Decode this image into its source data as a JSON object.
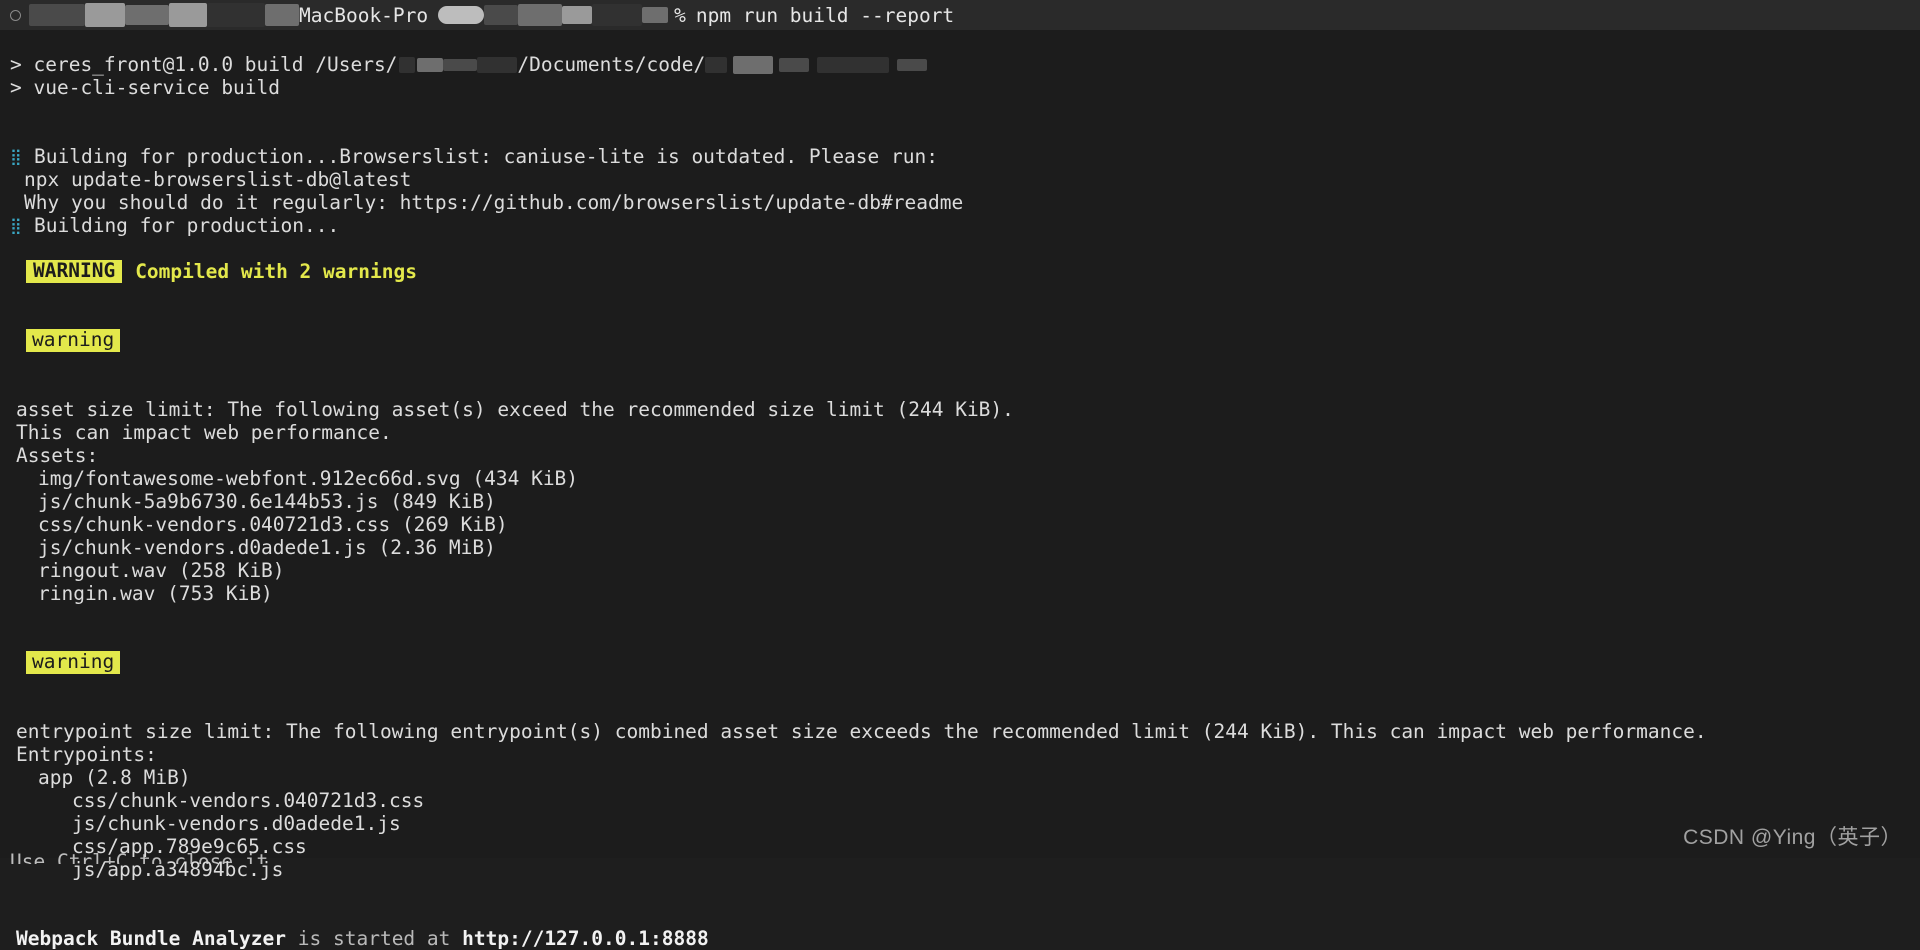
{
  "terminal": {
    "theme": {
      "background": "#1c1c1c",
      "prompt_bar_background": "#2a2a2a",
      "foreground": "#d8d8d8",
      "warning_badge_background": "#e3e84b",
      "warning_badge_foreground": "#1c1c1c",
      "warning_text": "#e3e84b",
      "spinner_color": "#3aa7c4"
    },
    "prompt": {
      "host_suffix": "MacBook-Pro",
      "prompt_symbol": "%",
      "command": "npm run build --report",
      "redacted_user": "",
      "redacted_path": ""
    },
    "npm_header": {
      "line1_prefix": "> ceres_front@1.0.0 build /Users/",
      "line1_middle": "/Documents/code/",
      "line2": "> vue-cli-service build"
    },
    "build_lines": {
      "spinner_glyph": "⣿",
      "building_browserslist": "Building for production...Browserslist: caniuse-lite is outdated. Please run:",
      "npx_update": "npx update-browserslist-db@latest",
      "why_regularly": "Why you should do it regularly: https://github.com/browserslist/update-db#readme",
      "building_again": "Building for production..."
    },
    "compiled": {
      "badge": "WARNING",
      "message": "Compiled with 2 warnings"
    },
    "warning_asset": {
      "badge": "warning",
      "headline": "asset size limit: The following asset(s) exceed the recommended size limit (244 KiB).",
      "subline": "This can impact web performance.",
      "section_label": "Assets:",
      "assets": [
        "img/fontawesome-webfont.912ec66d.svg (434 KiB)",
        "js/chunk-5a9b6730.6e144b53.js (849 KiB)",
        "css/chunk-vendors.040721d3.css (269 KiB)",
        "js/chunk-vendors.d0adede1.js (2.36 MiB)",
        "ringout.wav (258 KiB)",
        "ringin.wav (753 KiB)"
      ]
    },
    "warning_entrypoint": {
      "badge": "warning",
      "headline": "entrypoint size limit: The following entrypoint(s) combined asset size exceeds the recommended limit (244 KiB). This can impact web performance.",
      "section_label": "Entrypoints:",
      "entry_name": "app (2.8 MiB)",
      "entry_files": [
        "css/chunk-vendors.040721d3.css",
        "js/chunk-vendors.d0adede1.js",
        "css/app.789e9c65.css",
        "js/app.a34894bc.js"
      ]
    },
    "analyzer": {
      "name": "Webpack Bundle Analyzer",
      "middle": " is started at ",
      "url": "http://127.0.0.1:8888",
      "next_line_clipped": "Use Ctrl+C to close it"
    }
  },
  "watermark": {
    "text": "CSDN @Ying（英子）"
  }
}
